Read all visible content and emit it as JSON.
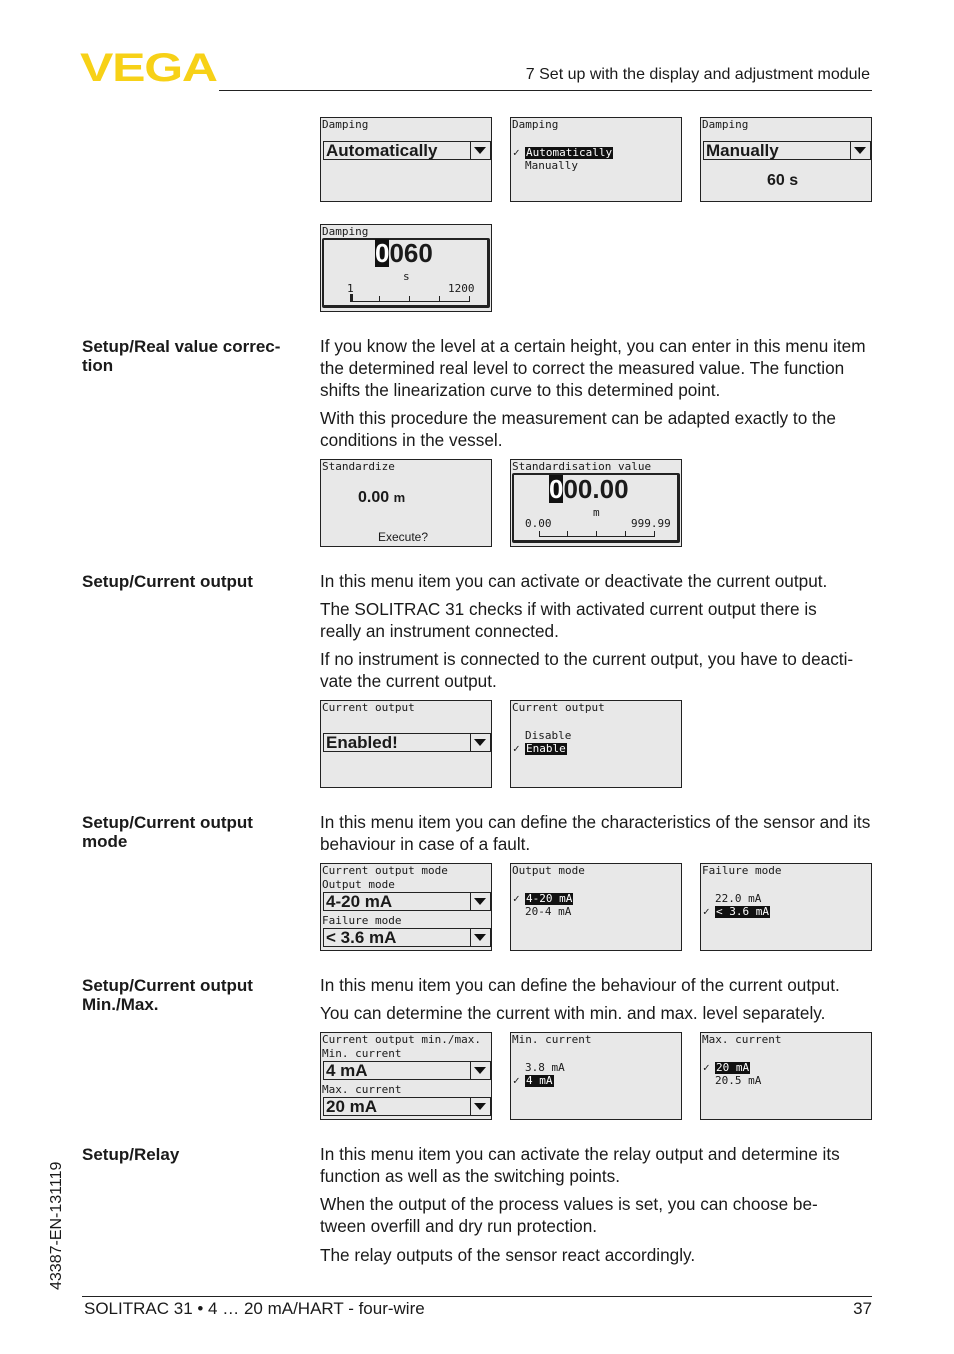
{
  "header": {
    "brand": "VEGA",
    "brand_color": "#f7d117",
    "chapter": "7 Set up with the display and adjustment module"
  },
  "screens_damping": {
    "s1": {
      "title": "Damping",
      "value": "Automatically"
    },
    "s2": {
      "title": "Damping",
      "options": [
        "Automatically",
        "Manually"
      ],
      "selected": "Automatically"
    },
    "s3": {
      "title": "Damping",
      "value": "Manually",
      "time": "60 s"
    },
    "s4": {
      "title": "Damping",
      "cursor_digit": "0",
      "rest_digits": "060",
      "unit": "s",
      "min": "1",
      "max": "1200"
    }
  },
  "sections": [
    {
      "label": "Setup/Real value correc-\ntion",
      "paragraphs": [
        "If you know the level at a certain height, you can enter in this menu item the determined real level to correct the measured value. The function shifts the linearization curve to this determined point.",
        "With this procedure the measurement can be adapted exactly to the conditions in the vessel."
      ]
    },
    {
      "label": "Setup/Current output",
      "paragraphs": [
        "In this menu item you can activate or deactivate the current output.",
        "The SOLITRAC 31 checks if with activated current output there is really an instrument connected.",
        "If no instrument is connected to the current output, you have to deacti-vate the current output."
      ]
    },
    {
      "label": "Setup/Current output mode",
      "paragraphs": [
        "In this menu item you can define the characteristics of the sensor and its behaviour in case of a fault."
      ]
    },
    {
      "label": "Setup/Current output Min./Max.",
      "paragraphs": [
        "In this menu item you can define the behaviour of the current output.",
        "You can determine the current with min. and max. level separately."
      ]
    },
    {
      "label": "Setup/Relay",
      "paragraphs": [
        "In this menu item you can activate the relay output and determine its function as well as the switching points.",
        "When the output of the process values is set, you can choose be-tween overfill and dry run protection.",
        "The relay outputs of the sensor react accordingly."
      ]
    }
  ],
  "screens_standardize": {
    "s1": {
      "title": "Standardize",
      "value": "0.00",
      "unit": "m",
      "prompt": "Execute?"
    },
    "s2": {
      "title": "Standardisation value",
      "cursor_digit": "0",
      "rest_digits": "00.00",
      "unit": "m",
      "min": "0.00",
      "max": "999.99"
    }
  },
  "screens_current_output": {
    "s1": {
      "title": "Current output",
      "value": "Enabled!"
    },
    "s2": {
      "title": "Current output",
      "options": [
        "Disable",
        "Enable"
      ],
      "selected": "Enable"
    }
  },
  "screens_output_mode": {
    "s1": {
      "title": "Current output mode",
      "label1": "Output mode",
      "value1": "4-20 mA",
      "label2": "Failure mode",
      "value2": "< 3.6 mA"
    },
    "s2": {
      "title": "Output mode",
      "options": [
        "4-20 mA",
        "20-4 mA"
      ],
      "selected": "4-20 mA"
    },
    "s3": {
      "title": "Failure mode",
      "options": [
        "22.0 mA",
        "< 3.6 mA"
      ],
      "selected": "< 3.6 mA"
    }
  },
  "screens_minmax": {
    "s1": {
      "title": "Current output min./max.",
      "label1": "Min. current",
      "value1": "4 mA",
      "label2": "Max. current",
      "value2": "20 mA"
    },
    "s2": {
      "title": "Min. current",
      "options": [
        "3.8 mA",
        "4 mA"
      ],
      "selected": "4 mA"
    },
    "s3": {
      "title": "Max. current",
      "options": [
        "20 mA",
        "20.5 mA"
      ],
      "selected": "20 mA"
    }
  },
  "footer": {
    "doc_title": "SOLITRAC 31 • 4 … 20 mA/HART - four-wire",
    "page_number": "37",
    "doc_code": "43387-EN-131119"
  }
}
